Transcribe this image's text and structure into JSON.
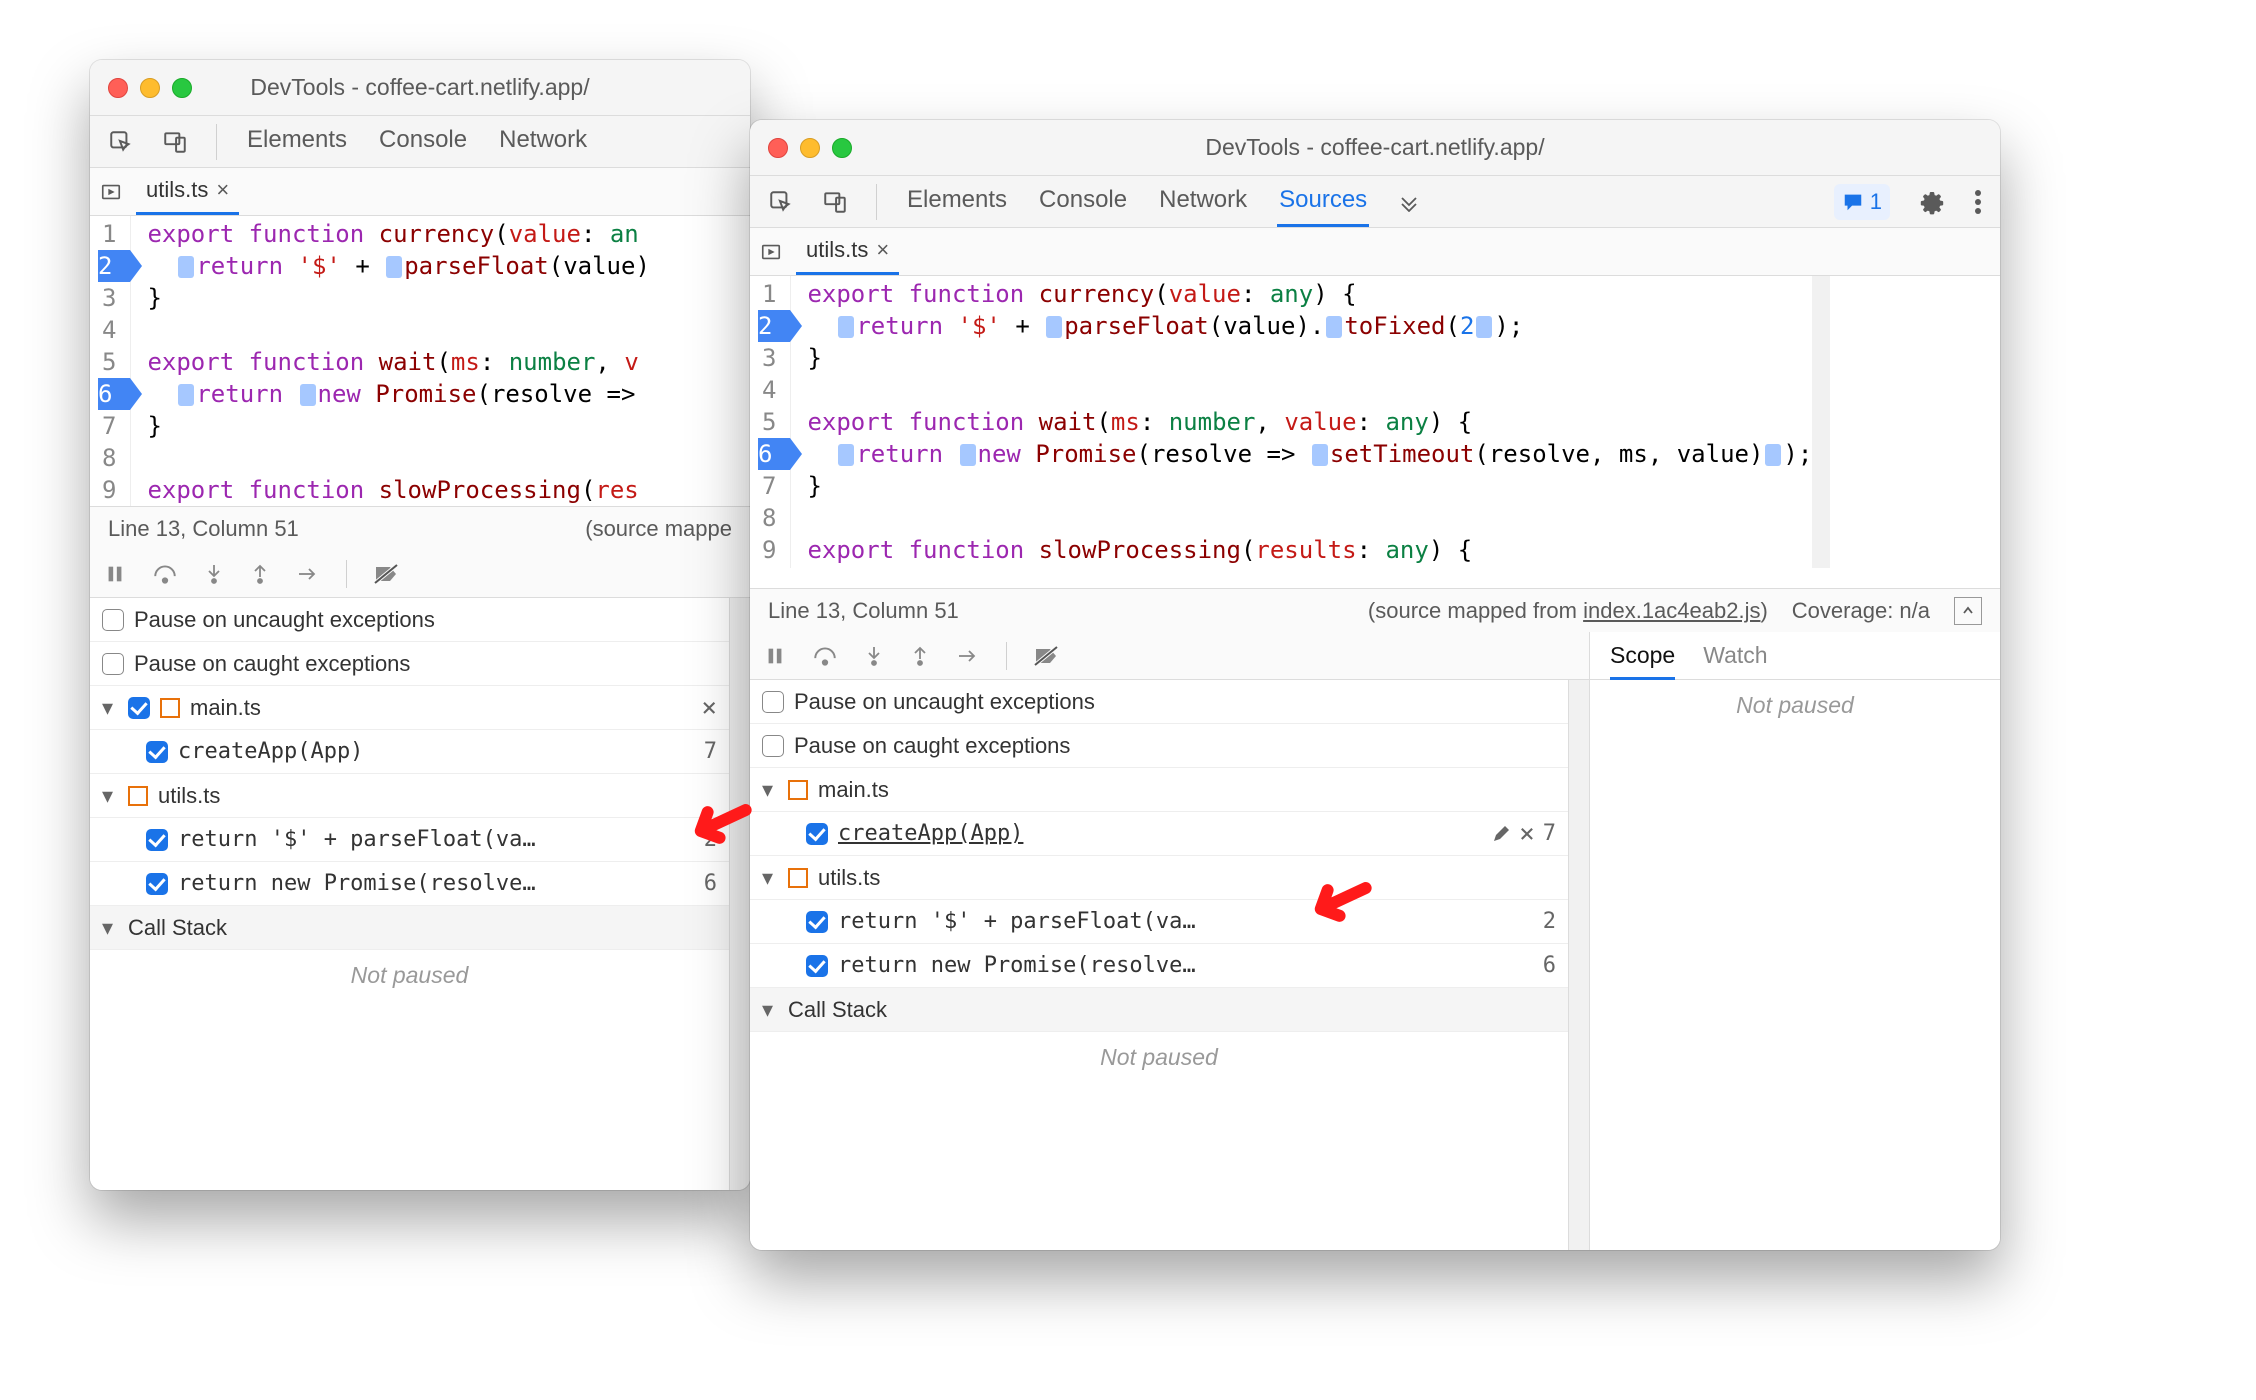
{
  "window_title": "DevTools - coffee-cart.netlify.app/",
  "tabs": {
    "elements": "Elements",
    "console": "Console",
    "network": "Network",
    "sources": "Sources"
  },
  "issue_count": "1",
  "file_tab": "utils.ts",
  "code": {
    "l1_a": "export",
    "l1_b": "function",
    "l1_c": "currency",
    "l1_d": "value",
    "l1_e": "any",
    "l2_a": "return",
    "l2_b": "'$'",
    "l2_c": "parseFloat",
    "l2_d": "value",
    "l2_e": "toFixed",
    "l2_f": "2",
    "l3": "}",
    "l5_a": "export",
    "l5_b": "function",
    "l5_c": "wait",
    "l5_d": "ms",
    "l5_e": "number",
    "l5_f": "value",
    "l5_g": "any",
    "l6_a": "return",
    "l6_b": "new",
    "l6_c": "Promise",
    "l6_d": "resolve",
    "l6_e": "setTimeout",
    "l6_f": "resolve",
    "l6_g": "ms",
    "l6_h": "value",
    "l7": "}",
    "l9_a": "export",
    "l9_b": "function",
    "l9_c": "slowProcessing",
    "l9_d": "results",
    "l9_e": "any"
  },
  "status": {
    "pos": "Line 13, Column 51",
    "sm_pre": "(source mapped from ",
    "sm_link": "index.1ac4eab2.js",
    "sm_suf": ")",
    "coverage": "Coverage: n/a",
    "sm_short": "(source mappe"
  },
  "bp": {
    "pause_uncaught": "Pause on uncaught exceptions",
    "pause_caught": "Pause on caught exceptions",
    "file1": "main.ts",
    "bp1": "createApp(App)",
    "bp1_line": "7",
    "file2": "utils.ts",
    "bp2": "return '$' + parseFloat(va…",
    "bp2_line": "2",
    "bp3": "return new Promise(resolve…",
    "bp3_line": "6",
    "callstack": "Call Stack",
    "notpaused": "Not paused"
  },
  "right": {
    "scope": "Scope",
    "watch": "Watch",
    "notpaused": "Not paused"
  },
  "ln": {
    "1": "1",
    "2": "2",
    "3": "3",
    "4": "4",
    "5": "5",
    "6": "6",
    "7": "7",
    "8": "8",
    "9": "9"
  }
}
